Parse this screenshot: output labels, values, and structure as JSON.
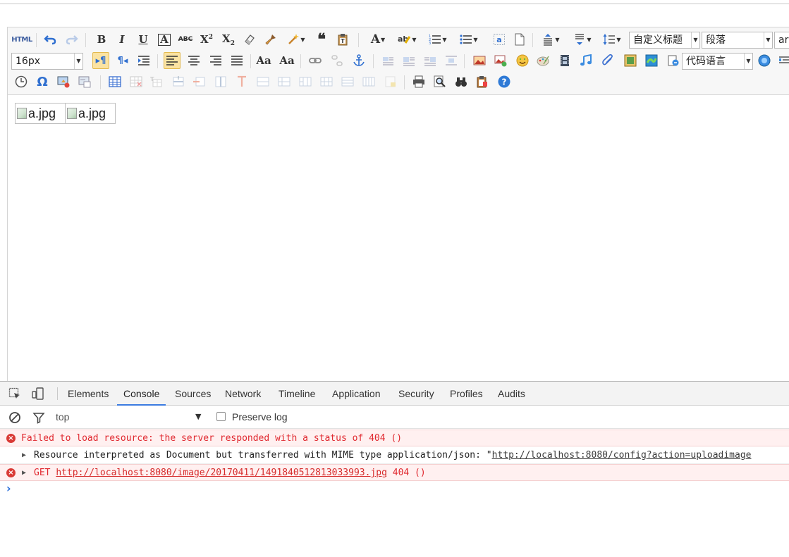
{
  "toolbar": {
    "row1": {
      "html_label": "HTML",
      "custom_heading": "自定义标题",
      "paragraph": "段落",
      "font_family_partial": "ar"
    },
    "row2": {
      "font_size": "16px",
      "code_language": "代码语言"
    }
  },
  "content": {
    "images": [
      {
        "alt": "a.jpg"
      },
      {
        "alt": "a.jpg"
      }
    ]
  },
  "devtools": {
    "tabs": [
      "Elements",
      "Console",
      "Sources",
      "Network",
      "Timeline",
      "Application",
      "Security",
      "Profiles",
      "Audits"
    ],
    "active_tab": "Console",
    "context": "top",
    "preserve_log_label": "Preserve log",
    "preserve_log_checked": false,
    "logs": [
      {
        "level": "error",
        "text": "Failed to load resource: the server responded with a status of 404 ()"
      },
      {
        "level": "info",
        "prefix": "Resource interpreted as Document but transferred with MIME type application/json: \"",
        "link": "http://localhost:8080/config?action=uploadimage"
      },
      {
        "level": "error",
        "prefix": "GET ",
        "link": "http://localhost:8080/image/20170411/1491840512813033993.jpg",
        "suffix": " 404 ()"
      }
    ],
    "prompt": "›"
  },
  "colors": {
    "active_tab_underline": "#3b7be0",
    "error_text": "#e0282f",
    "error_bg": "#fff0f0",
    "active_button_bg": "#fbe3a2",
    "help_icon": "#2f7ad6"
  }
}
